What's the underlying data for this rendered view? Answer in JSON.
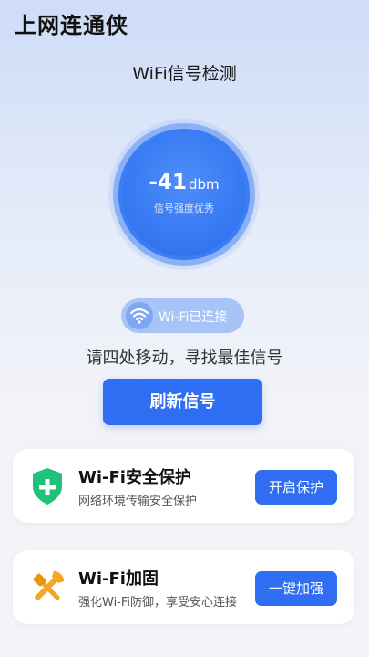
{
  "app_title": "上网连通侠",
  "page_heading": "WiFi信号检测",
  "signal": {
    "value": "-41",
    "unit": "dbm",
    "quality": "信号强度优秀"
  },
  "status_pill": {
    "icon": "wifi-icon",
    "label": "Wi-Fi已连接"
  },
  "hint": "请四处移动，寻找最佳信号",
  "refresh_button": "刷新信号",
  "cards": [
    {
      "icon": "shield-plus-icon",
      "title": "Wi-Fi安全保护",
      "description": "网络环境传输安全保护",
      "button": "开启保护"
    },
    {
      "icon": "wrench-screwdriver-icon",
      "title": "Wi-Fi加固",
      "description": "强化Wi-Fi防御，享受安心连接",
      "button": "一键加强"
    }
  ],
  "colors": {
    "accent": "#2f6df2",
    "shield_green": "#1fc27a",
    "tools_orange": "#f5a623"
  }
}
